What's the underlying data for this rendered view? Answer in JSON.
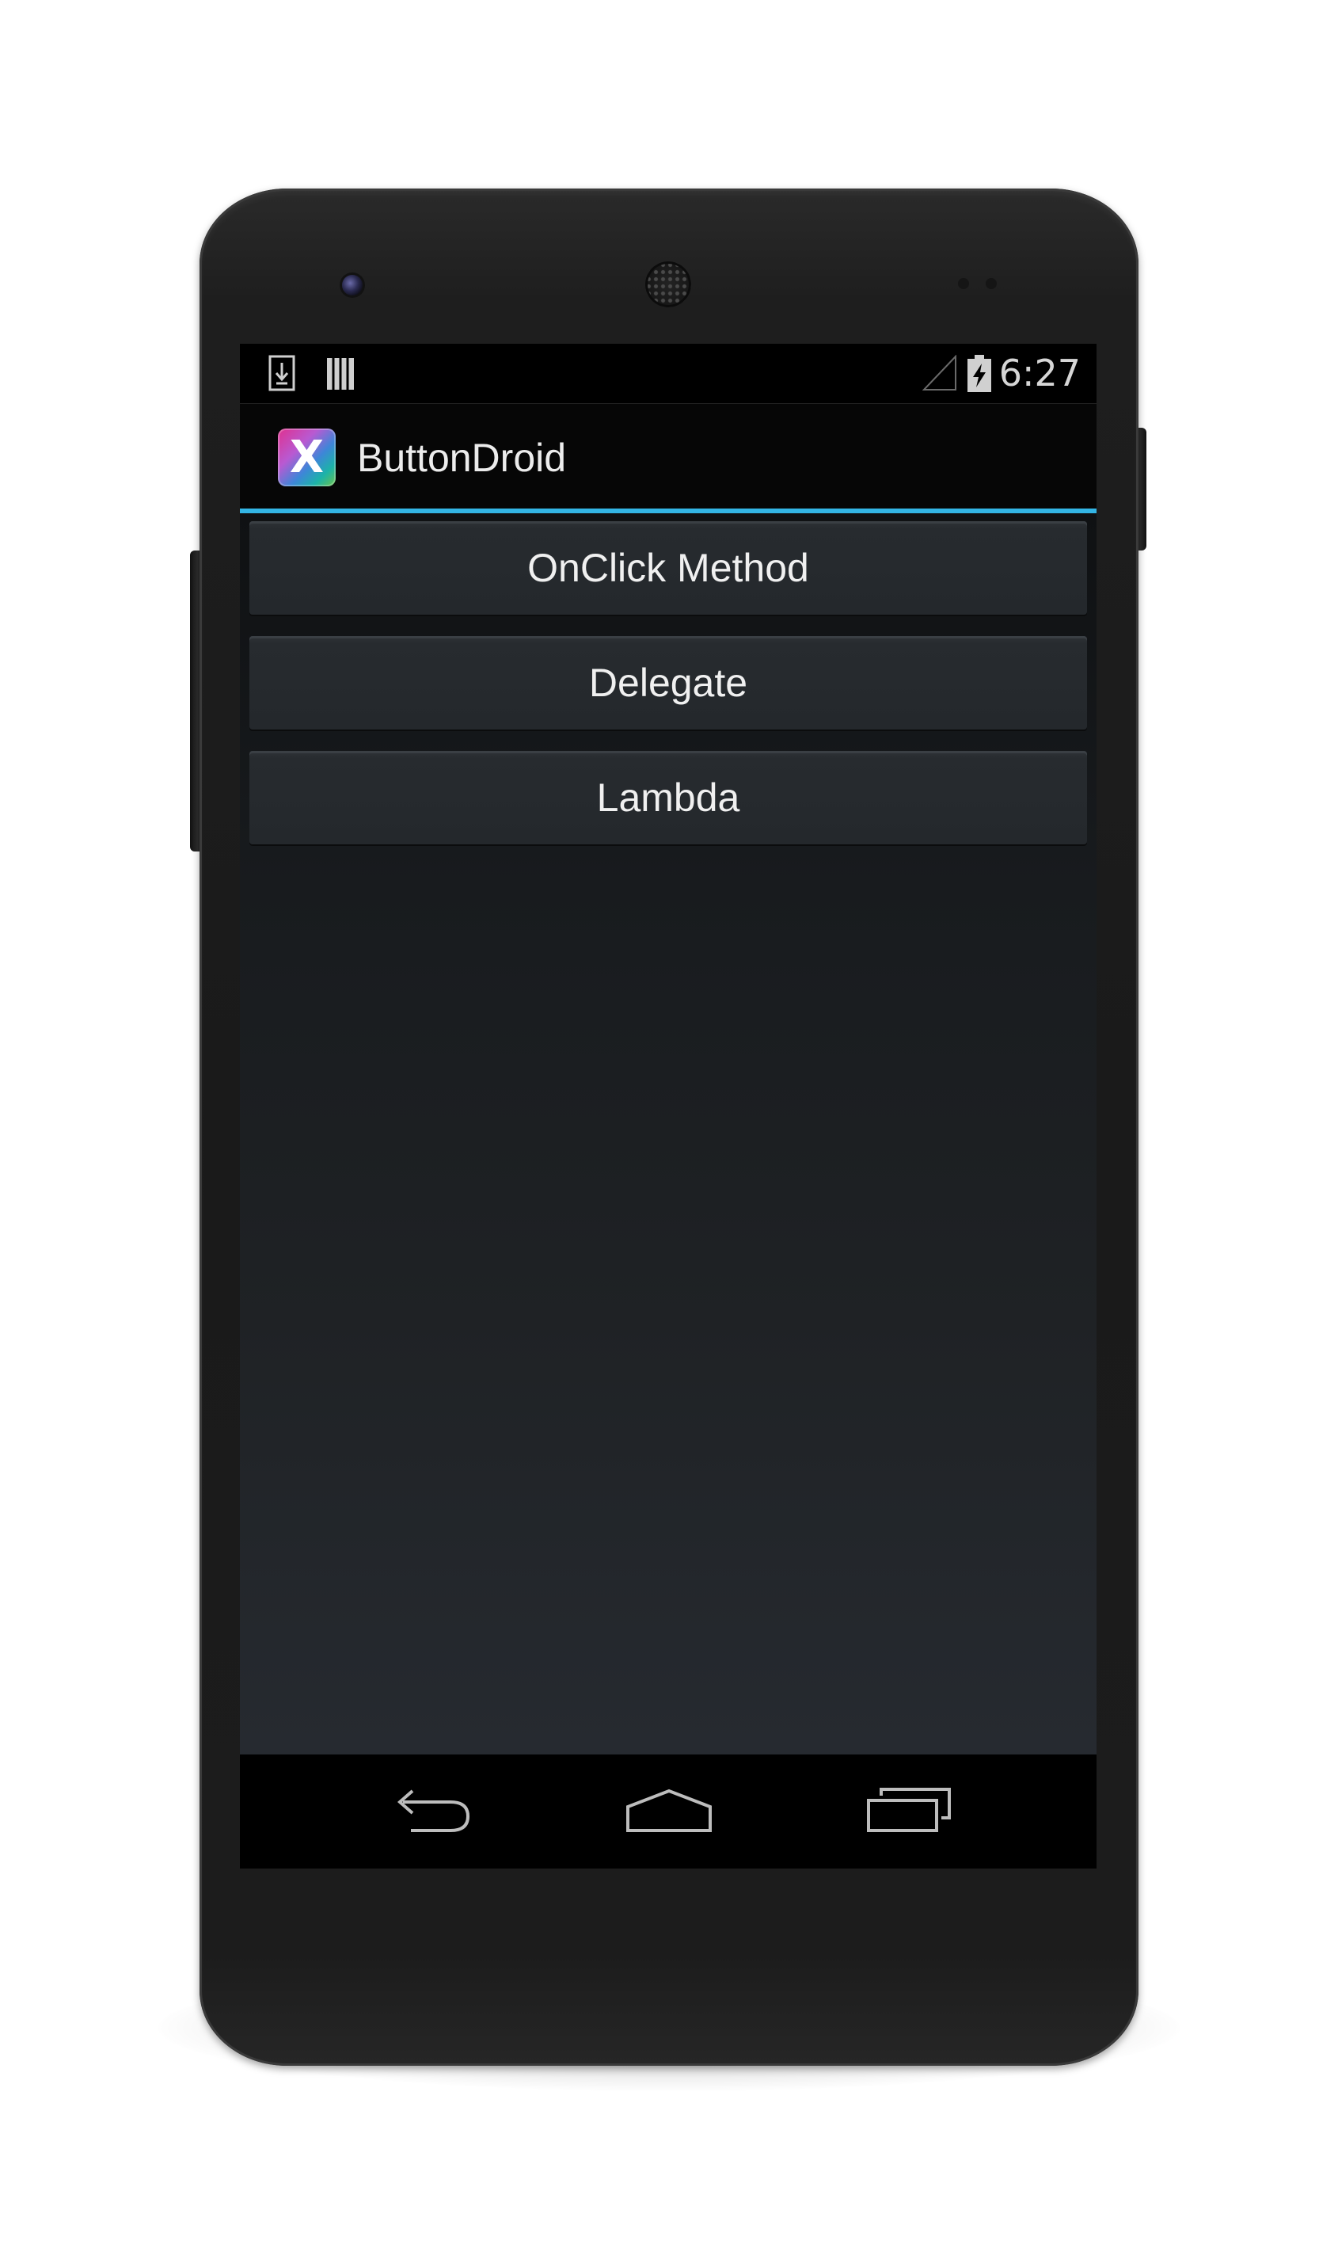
{
  "device": {
    "camera_icon": "front-camera",
    "speaker_icon": "earpiece-speaker"
  },
  "status_bar": {
    "time": "6:27",
    "left_icons": [
      "download-notification-icon",
      "storage-notification-icon"
    ],
    "right_icons": [
      "signal-icon",
      "battery-charging-icon"
    ]
  },
  "action_bar": {
    "app_icon": "xamarin-x-icon",
    "app_icon_letter": "X",
    "title": "ButtonDroid",
    "accent_color": "#33b5e5"
  },
  "buttons": [
    {
      "label": "OnClick Method"
    },
    {
      "label": "Delegate"
    },
    {
      "label": "Lambda"
    }
  ],
  "nav_bar": {
    "back_icon": "back-icon",
    "home_icon": "home-icon",
    "recents_icon": "recent-apps-icon"
  },
  "colors": {
    "screen_background": "#000000",
    "button_background": "#24282c",
    "button_text": "#f0f0f0",
    "accent": "#33b5e5"
  }
}
